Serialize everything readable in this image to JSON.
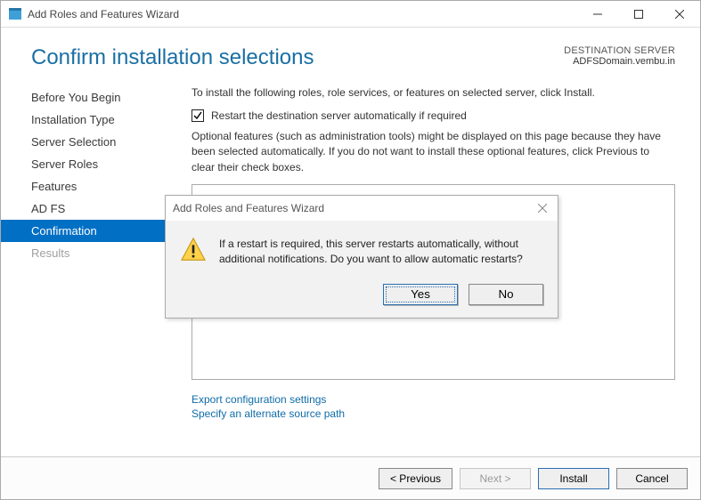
{
  "window": {
    "title": "Add Roles and Features Wizard"
  },
  "header": {
    "page_title": "Confirm installation selections",
    "dest_label": "DESTINATION SERVER",
    "dest_server": "ADFSDomain.vembu.in"
  },
  "sidebar": {
    "items": [
      {
        "label": "Before You Begin"
      },
      {
        "label": "Installation Type"
      },
      {
        "label": "Server Selection"
      },
      {
        "label": "Server Roles"
      },
      {
        "label": "Features"
      },
      {
        "label": "AD FS"
      },
      {
        "label": "Confirmation"
      },
      {
        "label": "Results"
      }
    ],
    "active_index": 6,
    "disabled_index": 7
  },
  "content": {
    "intro": "To install the following roles, role services, or features on selected server, click Install.",
    "restart_checkbox_label": "Restart the destination server automatically if required",
    "restart_checked": true,
    "optional_text": "Optional features (such as administration tools) might be displayed on this page because they have been selected automatically. If you do not want to install these optional features, click Previous to clear their check boxes.",
    "links": {
      "export": "Export configuration settings",
      "alt_source": "Specify an alternate source path"
    }
  },
  "footer": {
    "previous": "< Previous",
    "next": "Next >",
    "install": "Install",
    "cancel": "Cancel"
  },
  "modal": {
    "title": "Add Roles and Features Wizard",
    "message": "If a restart is required, this server restarts automatically, without additional notifications. Do you want to allow automatic restarts?",
    "yes": "Yes",
    "no": "No"
  }
}
